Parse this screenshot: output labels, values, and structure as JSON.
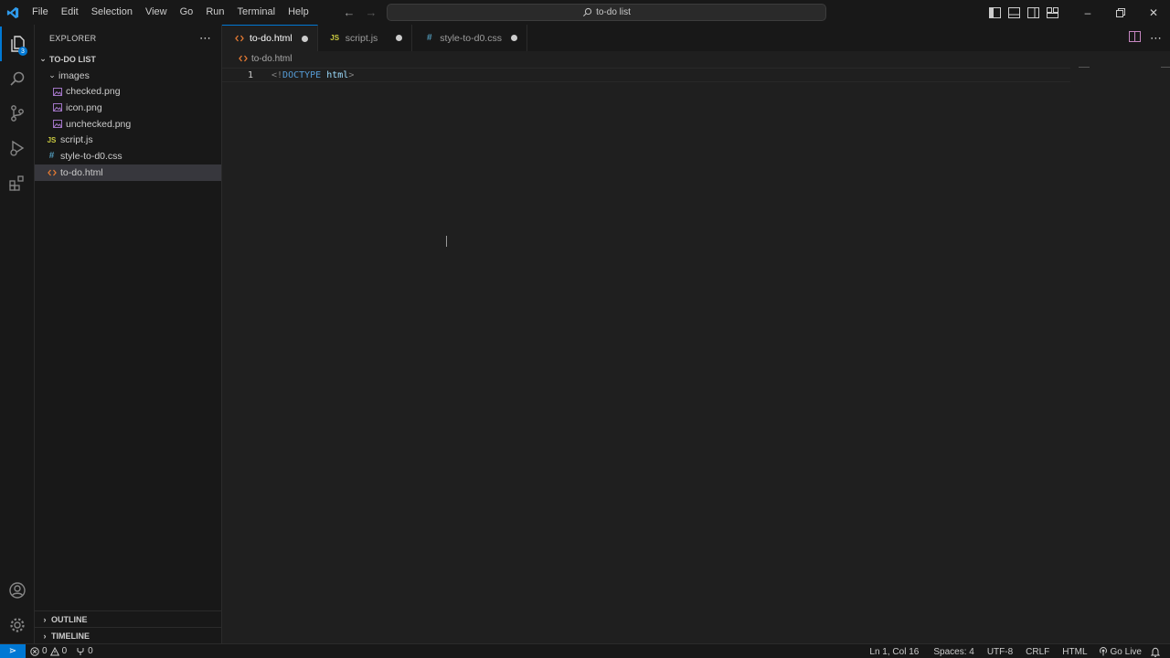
{
  "titlebar": {
    "menu": [
      "File",
      "Edit",
      "Selection",
      "View",
      "Go",
      "Run",
      "Terminal",
      "Help"
    ],
    "search_text": "to-do list"
  },
  "sidebar": {
    "title": "EXPLORER",
    "root_folder": "TO-DO LIST",
    "tree": [
      {
        "label": "images",
        "type": "folder",
        "depth": 1
      },
      {
        "label": "checked.png",
        "type": "image",
        "depth": 2
      },
      {
        "label": "icon.png",
        "type": "image",
        "depth": 2
      },
      {
        "label": "unchecked.png",
        "type": "image",
        "depth": 2
      },
      {
        "label": "script.js",
        "type": "js",
        "depth": 1
      },
      {
        "label": "style-to-d0.css",
        "type": "css",
        "depth": 1
      },
      {
        "label": "to-do.html",
        "type": "html",
        "depth": 1,
        "selected": true
      }
    ],
    "sections": [
      "OUTLINE",
      "TIMELINE"
    ]
  },
  "tabs": [
    {
      "label": "to-do.html",
      "type": "html",
      "active": true,
      "dirty": true
    },
    {
      "label": "script.js",
      "type": "js",
      "active": false,
      "dirty": true
    },
    {
      "label": "style-to-d0.css",
      "type": "css",
      "active": false,
      "dirty": true
    }
  ],
  "breadcrumb": "to-do.html",
  "editor": {
    "line_number": "1",
    "code": {
      "open": "<!",
      "keyword": "DOCTYPE",
      "attr": "html",
      "close": ">"
    }
  },
  "statusbar": {
    "errors": "0",
    "warnings": "0",
    "ports": "0",
    "position": "Ln 1, Col 16",
    "spaces": "Spaces: 4",
    "encoding": "UTF-8",
    "eol": "CRLF",
    "language": "HTML",
    "golive": "Go Live"
  },
  "colors": {
    "accent": "#0078d4",
    "js": "#cbcb41",
    "css": "#519aba",
    "html": "#e37933",
    "image": "#a074c4"
  },
  "icons": [
    "vscode-logo-icon",
    "files-icon",
    "search-icon",
    "source-control-icon",
    "run-debug-icon",
    "extensions-icon",
    "account-icon",
    "manage-gear-icon"
  ]
}
